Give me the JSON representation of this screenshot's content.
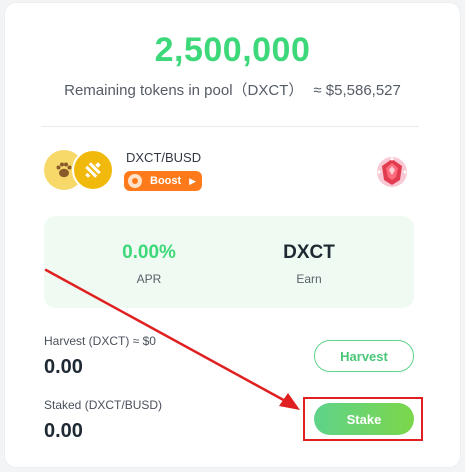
{
  "pool": {
    "total_tokens": "2,500,000",
    "remaining_label": "Remaining tokens in pool（DXCT）",
    "usd_value": "≈ $5,586,527"
  },
  "farm": {
    "pair_name": "DXCT/BUSD",
    "boost_label": "Boost",
    "token_icons": [
      "paw-token-icon",
      "busd-token-icon"
    ],
    "badge_icon": "gem-badge-icon"
  },
  "stats": {
    "apr_value": "0.00%",
    "apr_label": "APR",
    "earn_value": "DXCT",
    "earn_label": "Earn"
  },
  "harvest": {
    "label": "Harvest (DXCT) ≈ $0",
    "value": "0.00",
    "button_label": "Harvest"
  },
  "staked": {
    "label": "Staked (DXCT/BUSD)",
    "value": "0.00",
    "button_label": "Stake"
  },
  "colors": {
    "accent_green": "#3dd87a",
    "boost_orange": "#ff7a1a",
    "annotation_red": "#e02020",
    "stats_bg": "#effbf2"
  }
}
